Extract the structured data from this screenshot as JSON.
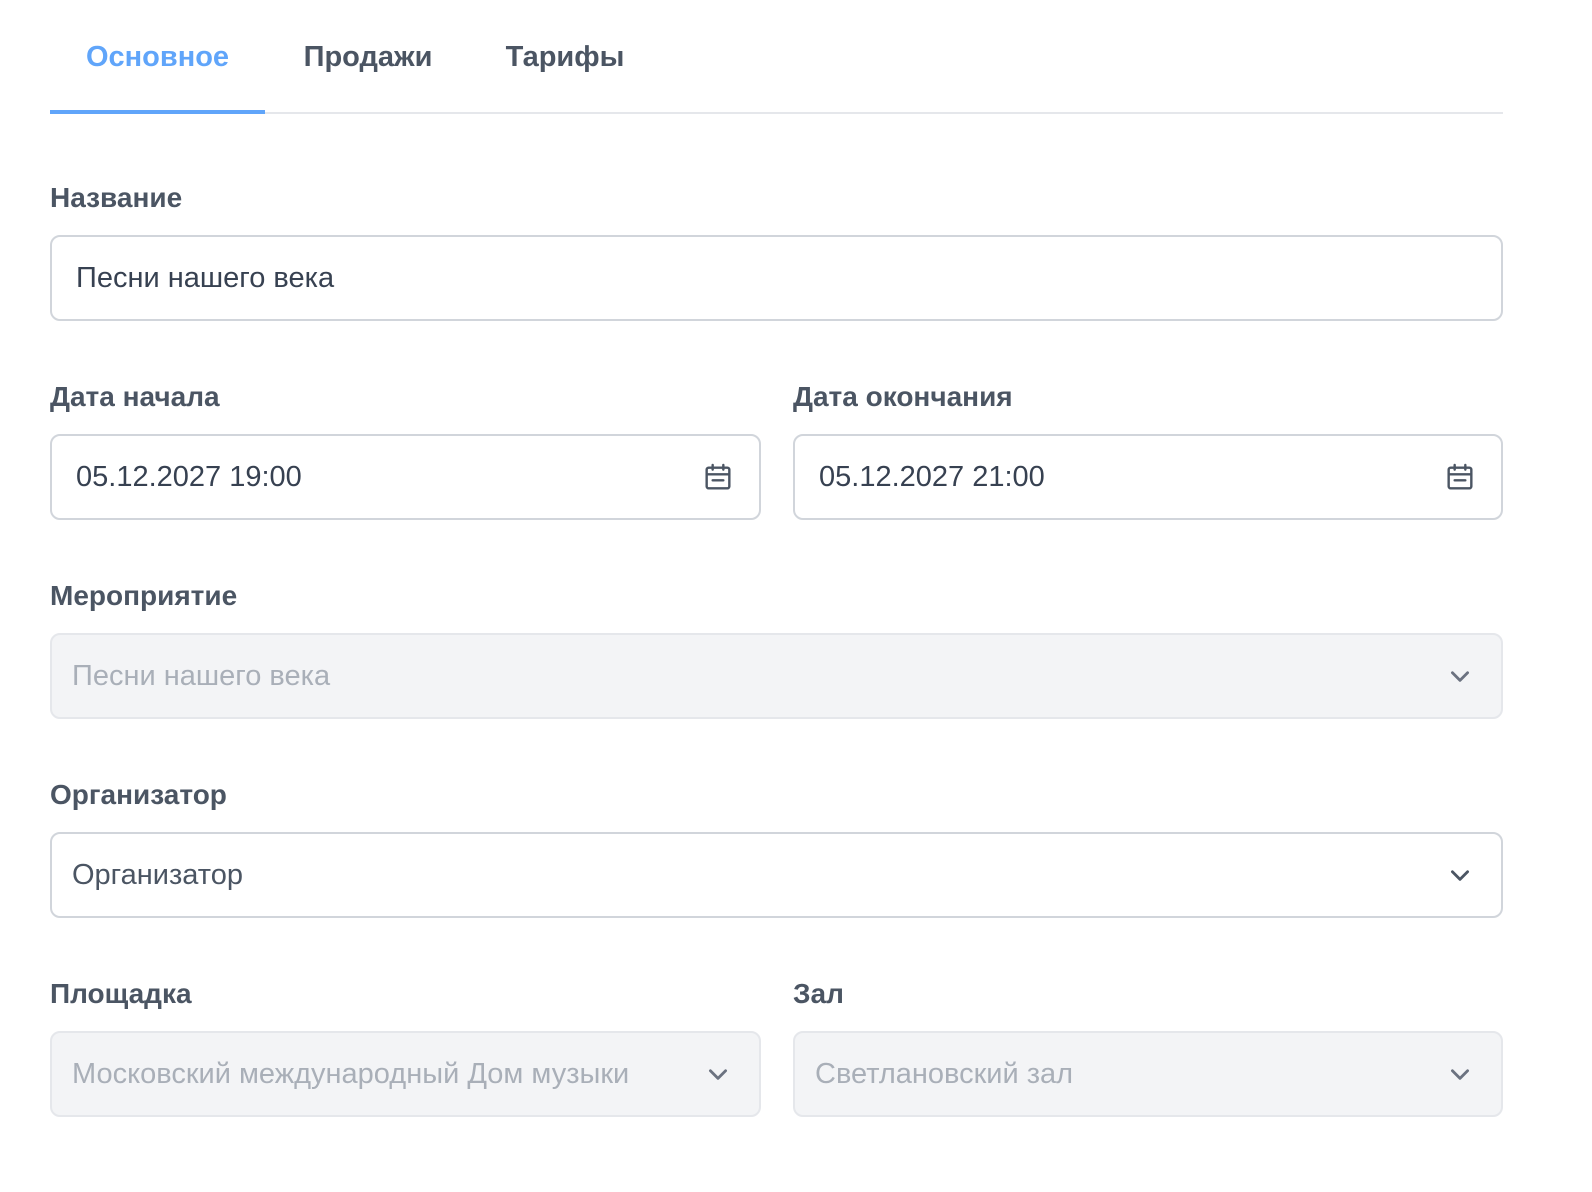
{
  "tabs": [
    {
      "label": "Основное",
      "active": true
    },
    {
      "label": "Продажи",
      "active": false
    },
    {
      "label": "Тарифы",
      "active": false
    }
  ],
  "form": {
    "name": {
      "label": "Название",
      "value": "Песни нашего века"
    },
    "start_date": {
      "label": "Дата начала",
      "value": "05.12.2027 19:00",
      "icon": "calendar-icon"
    },
    "end_date": {
      "label": "Дата окончания",
      "value": "05.12.2027 21:00",
      "icon": "calendar-icon"
    },
    "event": {
      "label": "Мероприятие",
      "value": "Песни нашего века",
      "disabled": true,
      "icon": "chevron-down-icon"
    },
    "organizer": {
      "label": "Организатор",
      "placeholder": "Организатор",
      "icon": "chevron-down-icon"
    },
    "venue": {
      "label": "Площадка",
      "value": "Московский международный Дом музыки",
      "disabled": true,
      "icon": "chevron-down-icon"
    },
    "hall": {
      "label": "Зал",
      "value": "Светлановский зал",
      "disabled": true,
      "icon": "chevron-down-icon"
    }
  },
  "colors": {
    "accent": "#60a5fa",
    "label": "#4b5563",
    "border": "#d1d5db",
    "disabled_bg": "#f3f4f6",
    "disabled_text": "#a9afb8"
  }
}
